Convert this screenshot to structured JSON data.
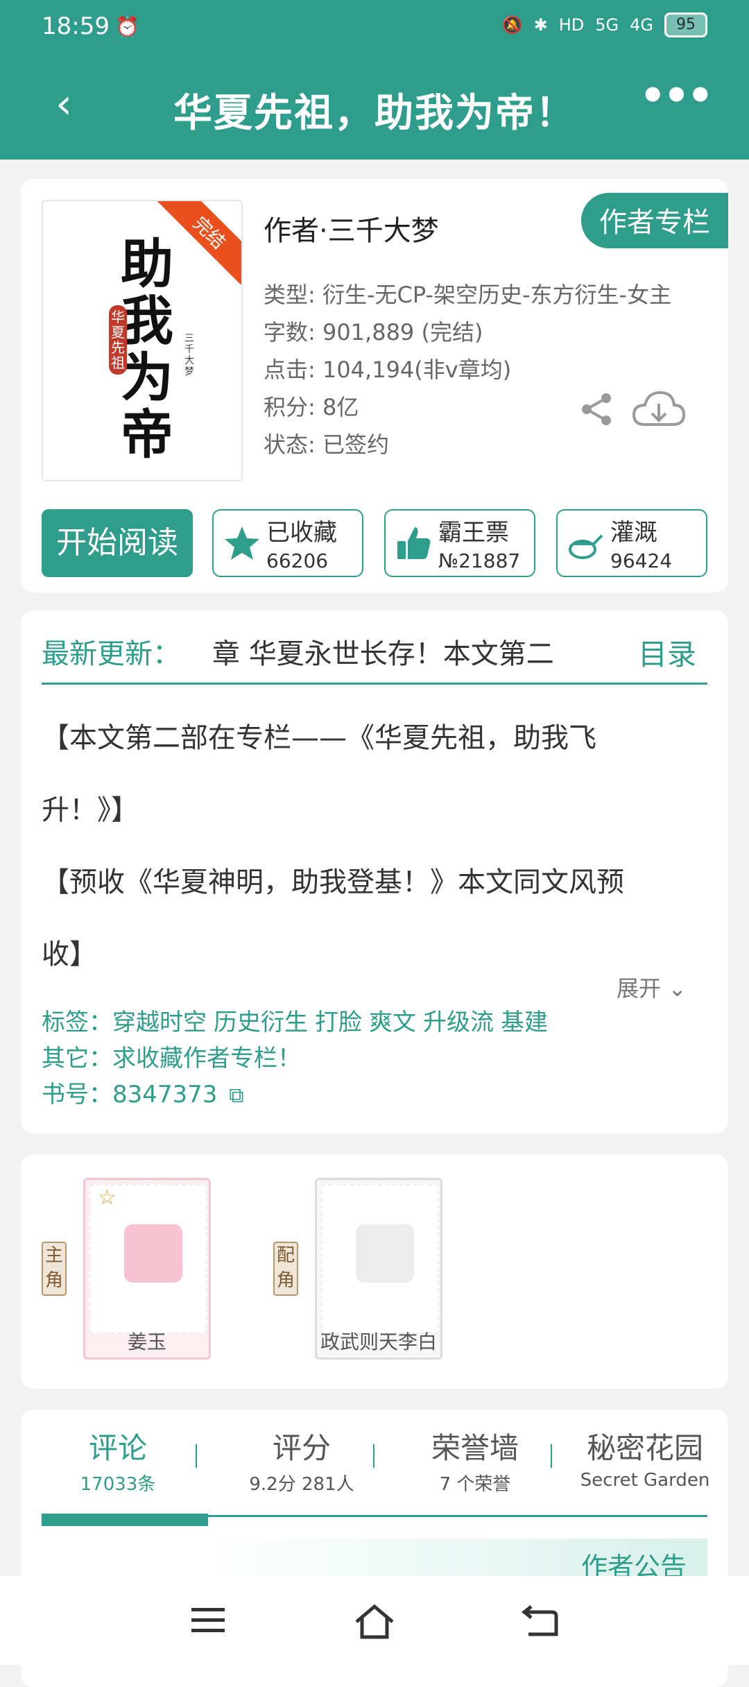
{
  "status_bar": {
    "time": "18:59",
    "network_5g": "5G",
    "network_4g": "4G",
    "hd": "HD",
    "battery": "95"
  },
  "header": {
    "title": "华夏先祖，助我为帝！"
  },
  "book": {
    "cover_title": "助我为帝",
    "cover_subtitle": "华夏先祖",
    "cover_author": "三千大梦",
    "cover_badge": "完结",
    "author": "作者·三千大梦",
    "author_column_btn": "作者专栏",
    "meta": [
      "类型: 衍生-无CP-架空历史-东方衍生-女主",
      "字数: 901,889 (完结)",
      "点击: 104,194(非v章均)",
      "积分: 8亿",
      "状态: 已签约"
    ],
    "read_btn": "开始阅读",
    "collect": {
      "label": "已收藏",
      "count": "66206"
    },
    "vote": {
      "label": "霸王票",
      "count": "№21887"
    },
    "water": {
      "label": "灌溉",
      "count": "96424"
    }
  },
  "update": {
    "label": "最新更新：",
    "text": "章  华夏永世长存！本文第二",
    "toc": "目录",
    "intro": [
      "【本文第二部在专栏——《华夏先祖，助我飞",
      "升！》】",
      "【预收《华夏神明，助我登基！》本文同文风预",
      "收】"
    ],
    "expand": "展开",
    "tags_label": "标签：",
    "tags": [
      "穿越时空",
      "历史衍生",
      "打脸",
      "爽文",
      "升级流",
      "基建"
    ],
    "other_label": "其它：",
    "other": "求收藏作者专栏！",
    "book_no_label": "书号：",
    "book_no": "8347373"
  },
  "roles": [
    {
      "type": "主角",
      "name": "姜玉"
    },
    {
      "type": "配角",
      "name": "政武则天李白"
    }
  ],
  "tabs": [
    {
      "label": "评论",
      "sub": "17033条"
    },
    {
      "label": "评分",
      "sub": "9.2分 281人"
    },
    {
      "label": "荣誉墙",
      "sub": "7 个荣誉"
    },
    {
      "label": "秘密花园",
      "sub": "Secret Garden"
    }
  ],
  "notice": "作者公告",
  "colors": {
    "primary": "#2e9d8b",
    "badge": "#e9501e"
  },
  "icons": [
    "back-icon",
    "more-icon",
    "share-icon",
    "download-icon",
    "star-icon",
    "thumb-icon",
    "watering-can-icon",
    "copy-icon",
    "chevron-down-icon",
    "menu-icon",
    "home-icon",
    "return-icon"
  ]
}
